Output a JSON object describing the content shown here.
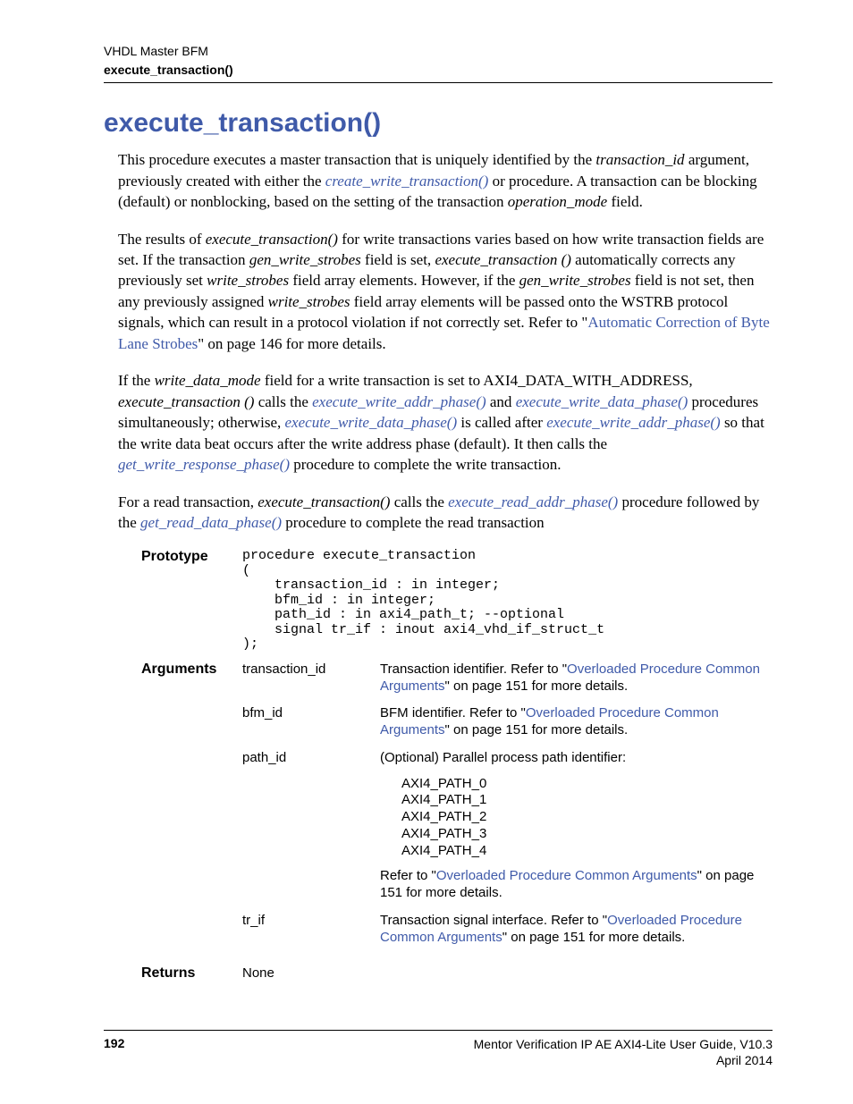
{
  "header": {
    "chapter": "VHDL Master BFM",
    "section": "execute_transaction()"
  },
  "title": "execute_transaction()",
  "p1": {
    "t1": "This procedure executes a master transaction that is uniquely identified by the ",
    "i1": "transaction_id",
    "t2": " argument, previously created with either the ",
    "l1": "create_write_transaction()",
    "t3": " or  procedure. A transaction can be blocking (default) or nonblocking, based on the setting of the transaction ",
    "i2": "operation_mode",
    "t4": " field."
  },
  "p2": {
    "t1": "The results of ",
    "i1": "execute_transaction()",
    "t2": " for write transactions varies based on how write transaction fields are set. If the transaction ",
    "i2": "gen_write_strobes",
    "t3": " field is set, ",
    "i3": "execute_transaction ()",
    "t4": " automatically corrects any previously set ",
    "i4": "write_strobes",
    "t5": " field array elements. However, if the ",
    "i5": "gen_write_strobes",
    "t6": " field is not set, then any previously assigned ",
    "i6": "write_strobes",
    "t7": " field array elements will be passed onto the WSTRB protocol signals, which can result in a protocol violation if not correctly set. Refer to \"",
    "l1": "Automatic Correction of Byte Lane Strobes",
    "t8": "\" on page 146 for more details."
  },
  "p3": {
    "t1": "If the ",
    "i1": "write_data_mode",
    "t2": " field for a write transaction is set to AXI4_DATA_WITH_ADDRESS",
    "i2": ", execute_transaction ()",
    "t3": " calls the ",
    "l1": "execute_write_addr_phase()",
    "t4": " and ",
    "l2": "execute_write_data_phase()",
    "t5": " procedures simultaneously; otherwise, ",
    "l3": "execute_write_data_phase()",
    "t6": " is called after ",
    "l4": "execute_write_addr_phase()",
    "t7": " so that the write data beat occurs after the write address phase (default). It then calls the ",
    "l5": "get_write_response_phase()",
    "t8": " procedure to complete the write transaction."
  },
  "p4": {
    "t1": "For a read transaction, ",
    "i1": "execute_transaction()",
    "t2": " calls the ",
    "l1": "execute_read_addr_phase()",
    "t3": " procedure followed by the ",
    "l2": "get_read_data_phase()",
    "t4": " procedure to complete the read transaction"
  },
  "prototype": {
    "label": "Prototype",
    "code": "procedure execute_transaction\n(\n    transaction_id : in integer;\n    bfm_id : in integer;\n    path_id : in axi4_path_t; --optional\n    signal tr_if : inout axi4_vhd_if_struct_t\n);"
  },
  "arguments": {
    "label": "Arguments",
    "items": [
      {
        "name": "transaction_id",
        "d1": "Transaction identifier. Refer to \"",
        "l1": "Overloaded Procedure Common Arguments",
        "d2": "\" on page 151 for more details."
      },
      {
        "name": "bfm_id",
        "d1": "BFM identifier. Refer to \"",
        "l1": "Overloaded Procedure Common Arguments",
        "d2": "\" on page 151 for more details."
      },
      {
        "name": "path_id",
        "d1": "(Optional) Parallel process path identifier:",
        "paths": [
          "AXI4_PATH_0",
          "AXI4_PATH_1",
          "AXI4_PATH_2",
          "AXI4_PATH_3",
          "AXI4_PATH_4"
        ],
        "d2a": "Refer to \"",
        "l1": "Overloaded Procedure Common Arguments",
        "d2b": "\" on page 151 for more details."
      },
      {
        "name": "tr_if",
        "d1": "Transaction signal interface. Refer to \"",
        "l1": "Overloaded Procedure Common Arguments",
        "d2": "\" on page 151 for more details."
      }
    ]
  },
  "returns": {
    "label": "Returns",
    "value": "None"
  },
  "footer": {
    "page": "192",
    "guide": "Mentor Verification IP AE AXI4-Lite User Guide, V10.3",
    "date": "April 2014"
  }
}
